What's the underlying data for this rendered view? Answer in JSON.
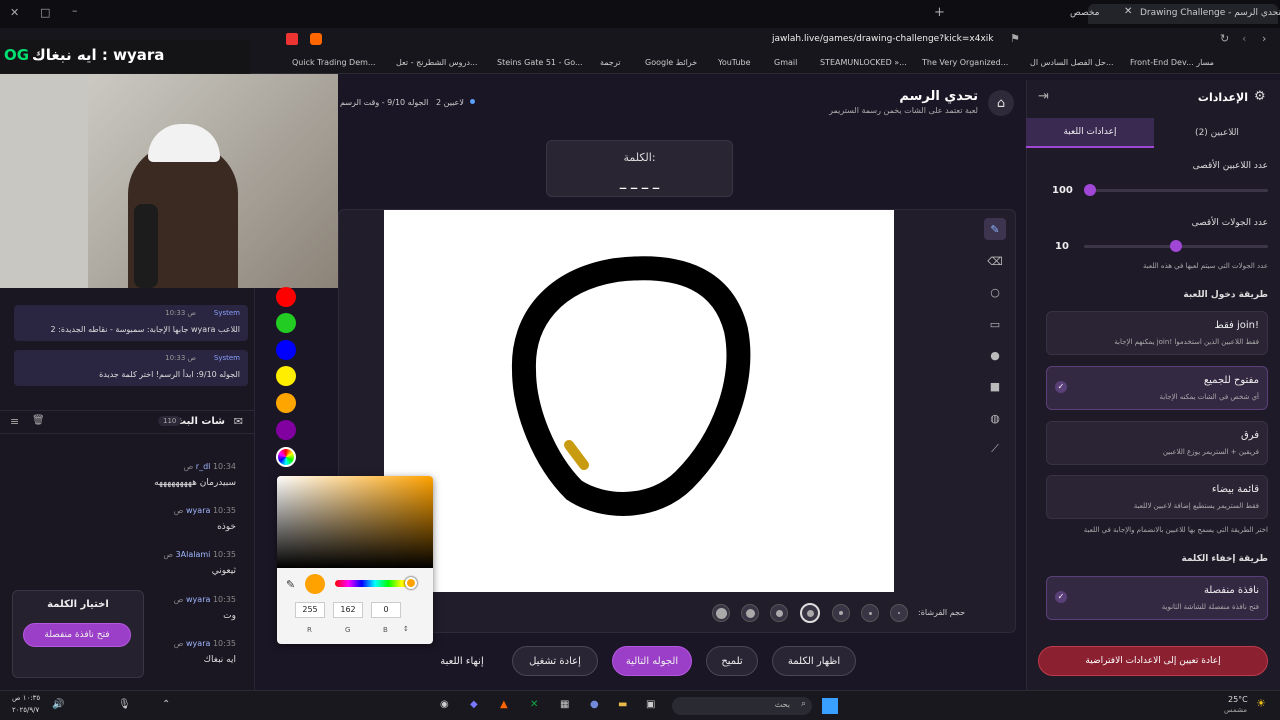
{
  "browser": {
    "tab_active": "Drawing Challenge - تحدي الرسم",
    "tab_other": "مخصص",
    "url": "jawlah.live/games/drawing-challenge?kick=x4xik",
    "bookmarks": [
      "Quick Trading Dem...",
      "دروس الشطرنج - تعل...",
      "Steins Gate 51 - Go...",
      "ترجمة",
      "Google خرائط",
      "YouTube",
      "Gmail",
      "STEAMUNLOCKED »...",
      "The Very Organized...",
      "حل الفصل السادس ال...",
      "Front-End Dev... مسار"
    ]
  },
  "overlay": {
    "title": "wyara : ايه نبغاك",
    "logo": "OG"
  },
  "header": {
    "title": "تحدي الرسم",
    "subtitle": "لعبة تعتمد على الشات يخمن رسمة الستريمر",
    "players": "2 لاعبين",
    "round": "الجوله 9/10 - وقت الرسم"
  },
  "word": {
    "label": "الكلمة:",
    "value": "_ _ _ _"
  },
  "system_messages": [
    {
      "sender": "System",
      "time": "10:33 ص",
      "text": "اللاعب wyara جابها الإجابة: سمبوسة - نقاطه الجديدة: 2"
    },
    {
      "sender": "System",
      "time": "10:33 ص",
      "text": "الجوله 9/10: ابدأ الرسم! اختر كلمة جديدة"
    }
  ],
  "chat": {
    "title": "شات البث",
    "count": "110",
    "messages": [
      {
        "name": "r_dl",
        "time": "10:34 ص",
        "text": "سبيدرمان هههههههههه"
      },
      {
        "name": "wyara",
        "time": "10:35 ص",
        "text": "خوذه"
      },
      {
        "name": "3Alalami",
        "time": "10:35 ص",
        "text": "ثيعوني"
      },
      {
        "name": "wyara",
        "time": "10:35 ص",
        "text": "وت"
      },
      {
        "name": "wyara",
        "time": "10:35 ص",
        "text": "ايه نبغاك"
      }
    ]
  },
  "choose_word": {
    "title": "اختيار الكلمة",
    "button": "فتح نافذة منفصلة"
  },
  "color_picker": {
    "r": "255",
    "g": "162",
    "b": "0",
    "r_label": "R",
    "g_label": "G",
    "b_label": "B",
    "current": "#ffa200"
  },
  "swatches": [
    "#ff0000",
    "#22cc22",
    "#0000ff",
    "#ffee00",
    "#ffa500",
    "#8000a0"
  ],
  "brush_label": "حجم الفرشاة:",
  "actions": {
    "end_game": "إنهاء اللعبة",
    "restart": "إعادة تشغيل",
    "next_round": "الجوله التالية",
    "hint": "تلميح",
    "show_word": "اظهار الكلمة"
  },
  "settings": {
    "title": "الإعدادات",
    "tab_game": "إعدادات اللعبة",
    "tab_players": "اللاعبين (2)",
    "max_players_label": "عدد اللاعبين الأقصى",
    "max_players": "100",
    "max_players_frac": 0.0,
    "max_rounds_label": "عدد الجولات الأقصى",
    "max_rounds": "10",
    "max_rounds_frac": 0.5,
    "rounds_hint": "عدد الجولات التي سيتم لعبها في هذه اللعبة",
    "join_method": "طريقة دخول اللعبة",
    "options": [
      {
        "title": "!join فقط",
        "desc": "فقط اللاعبين الذين استخدموا !join يمكنهم الإجابة",
        "checked": false
      },
      {
        "title": "مفتوح للجميع",
        "desc": "أي شخص في الشات يمكنه الإجابة",
        "checked": true
      },
      {
        "title": "فرق",
        "desc": "فريقين + الستريمر يوزع اللاعبين",
        "checked": false
      },
      {
        "title": "قائمة بيضاء",
        "desc": "فقط الستريمر يستطيع إضافة لاعبين لاللعبة",
        "checked": false
      }
    ],
    "join_hint": "اختر الطريقة التي يسمح بها للاعبين بالانضمام والإجابة في اللعبة",
    "hide_word": "طريقة إخفاء الكلمة",
    "hide_option": {
      "title": "نافذة منفصلة",
      "desc": "فتح نافذة منفصلة للشاشة الثانوية",
      "checked": true
    },
    "reset": "إعادة تعيين إلى الاعدادات الافتراضية"
  },
  "taskbar": {
    "search": "بحث",
    "weather": "25°C",
    "weather_sub": "مشمس",
    "time": "١٠:٣٥ ص",
    "date": "٢٠٢٥/٩/٧"
  }
}
